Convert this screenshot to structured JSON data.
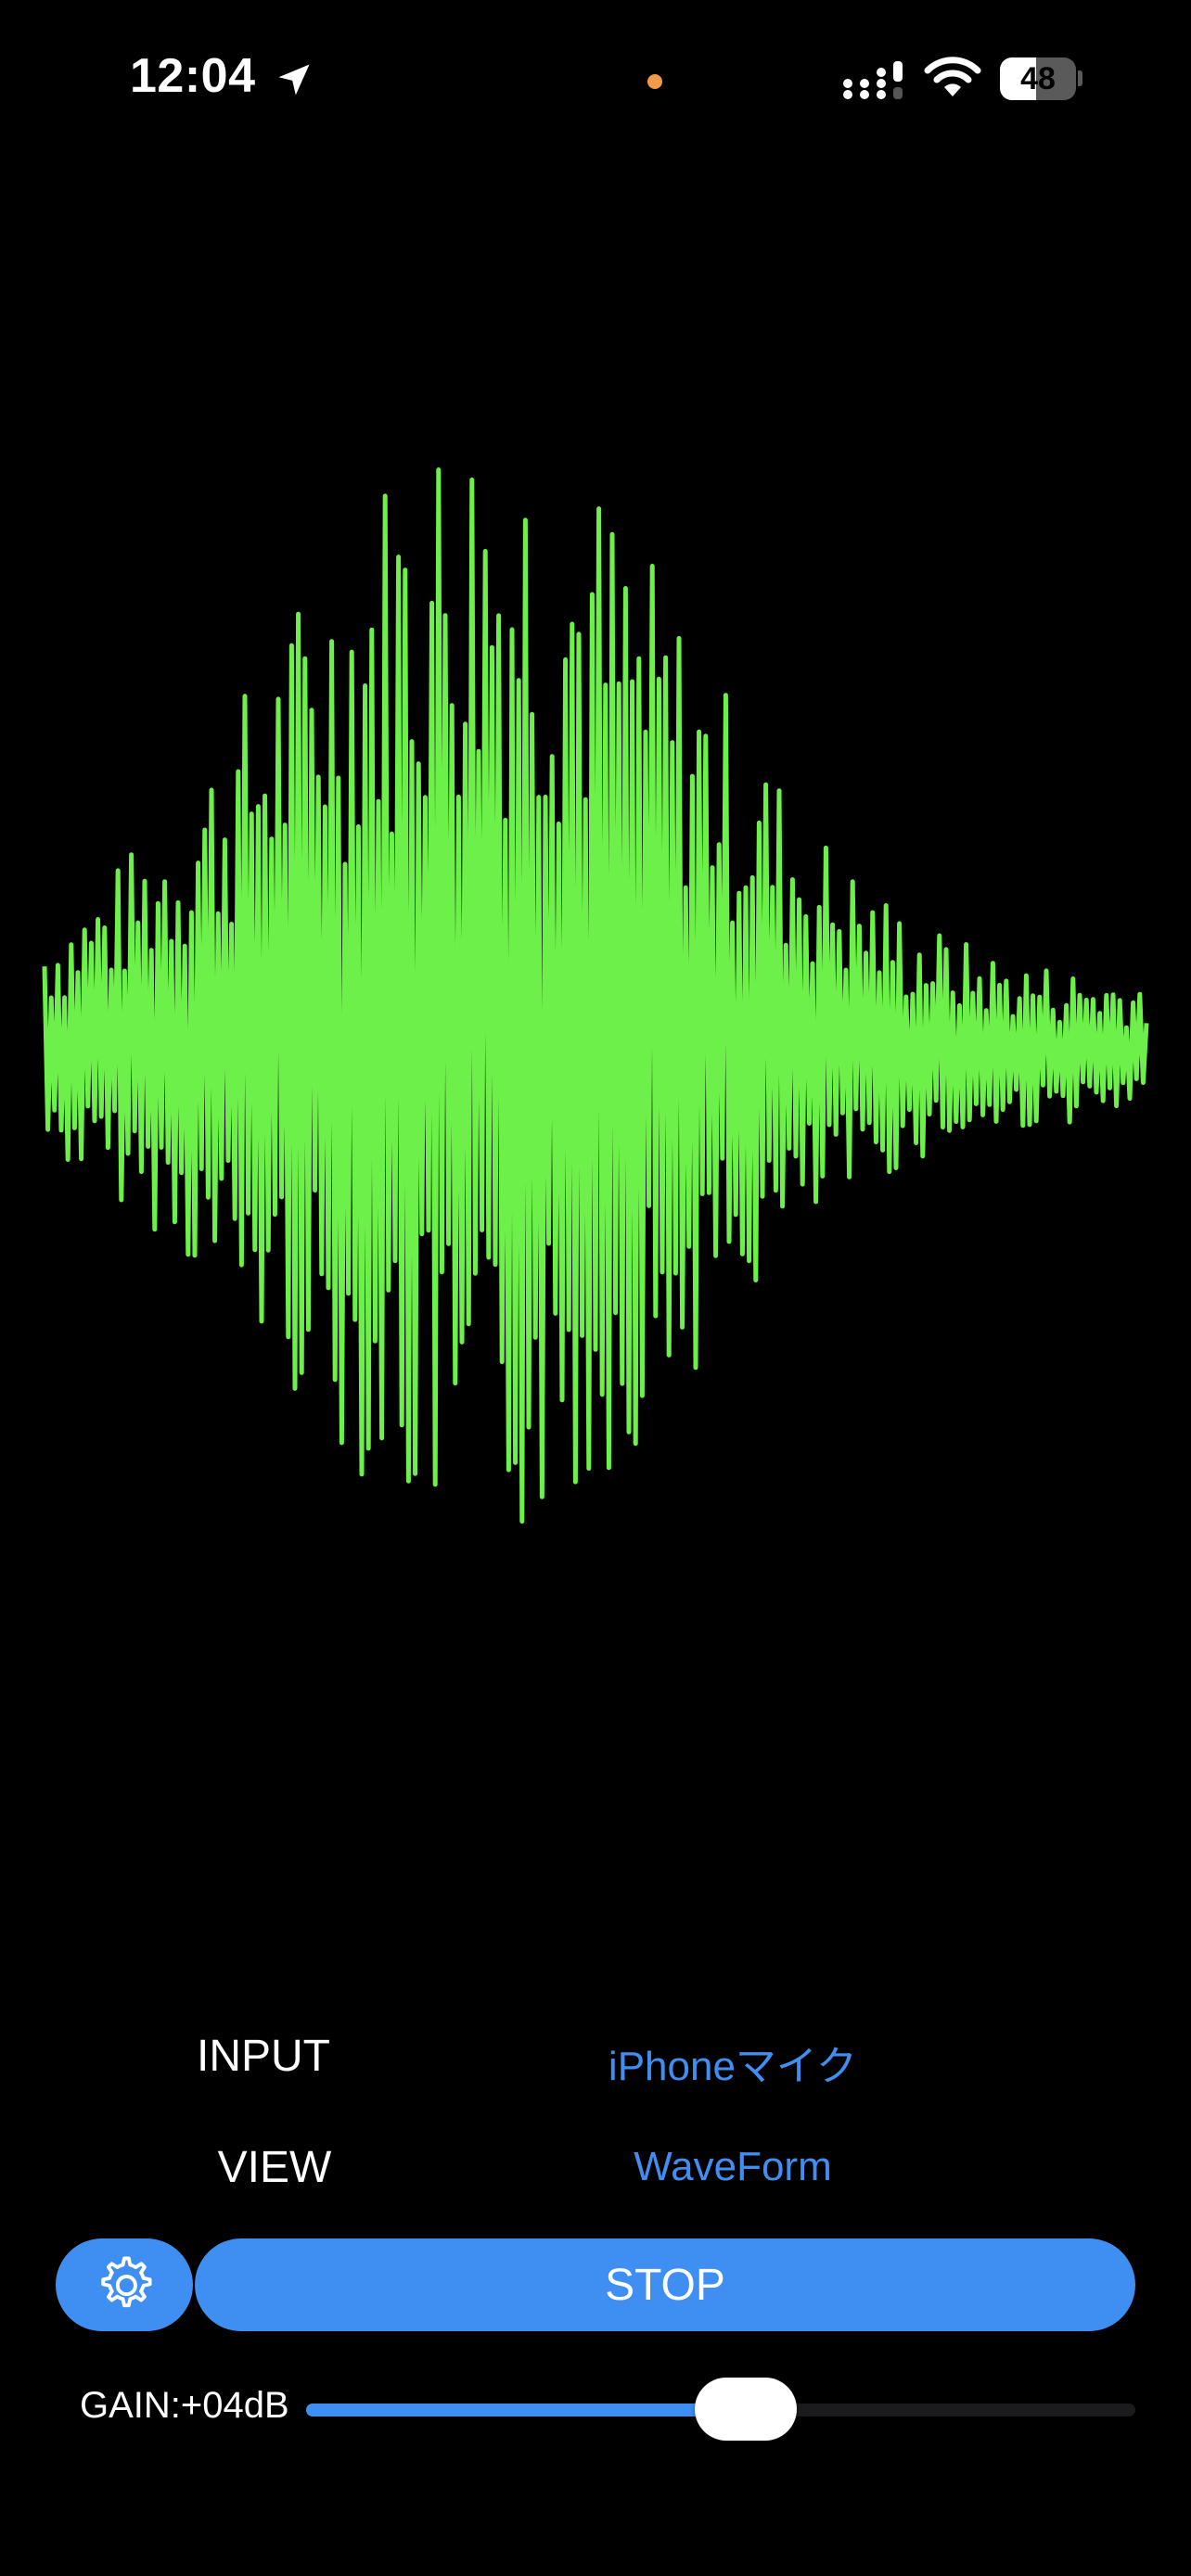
{
  "status_bar": {
    "time": "12:04",
    "battery_percent": "48",
    "battery_level": 0.48,
    "icons": [
      "location-arrow-icon",
      "signal-icon",
      "wifi-icon",
      "battery-icon"
    ],
    "mic_indicator_color": "#f09a4b"
  },
  "waveform": {
    "color": "#6ef04a",
    "view": "WaveForm"
  },
  "settings": {
    "input_label": "INPUT",
    "input_value": "iPhoneマイク",
    "view_label": "VIEW",
    "view_value": "WaveForm"
  },
  "controls": {
    "settings_icon": "gear-icon",
    "stop_label": "STOP",
    "accent_color": "#3f8ff2"
  },
  "gain": {
    "label": "GAIN:+04dB",
    "level": 0.53
  }
}
